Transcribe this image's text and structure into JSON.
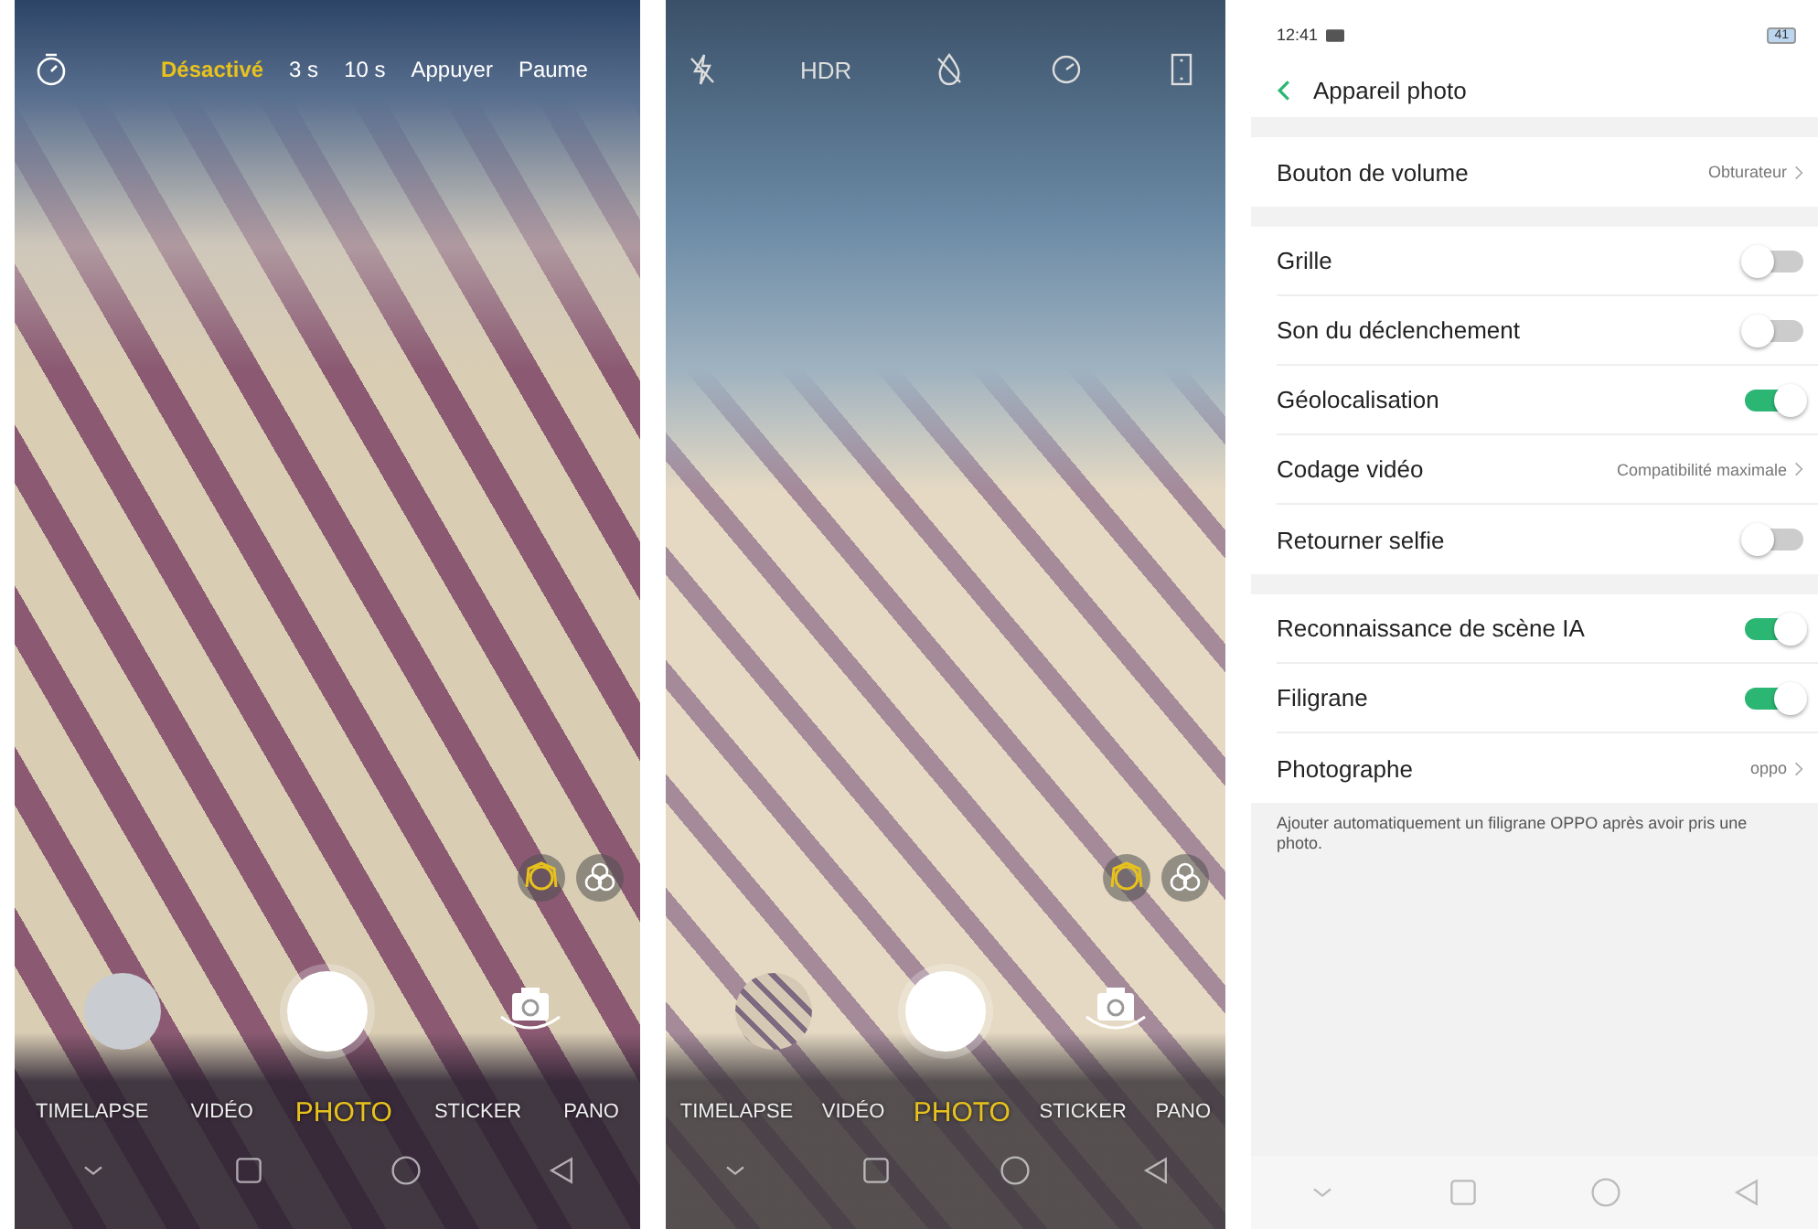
{
  "camera_timer_screen": {
    "timer_options": [
      {
        "label": "Désactivé",
        "selected": true
      },
      {
        "label": "3 s",
        "selected": false
      },
      {
        "label": "10 s",
        "selected": false
      },
      {
        "label": "Appuyer",
        "selected": false
      },
      {
        "label": "Paume",
        "selected": false
      }
    ],
    "modes": [
      {
        "label": "TIMELAPSE",
        "selected": false
      },
      {
        "label": "VIDÉO",
        "selected": false
      },
      {
        "label": "PHOTO",
        "selected": true
      },
      {
        "label": "STICKER",
        "selected": false
      },
      {
        "label": "PANO",
        "selected": false
      }
    ]
  },
  "camera_screen": {
    "hdr_label": "HDR",
    "modes": [
      {
        "label": "TIMELAPSE",
        "selected": false
      },
      {
        "label": "VIDÉO",
        "selected": false
      },
      {
        "label": "PHOTO",
        "selected": true
      },
      {
        "label": "STICKER",
        "selected": false
      },
      {
        "label": "PANO",
        "selected": false
      }
    ]
  },
  "settings_screen": {
    "status_time": "12:41",
    "battery": "41",
    "title": "Appareil photo",
    "groups": [
      [
        {
          "kind": "link",
          "label": "Bouton de volume",
          "value": "Obturateur"
        }
      ],
      [
        {
          "kind": "toggle",
          "label": "Grille",
          "on": false
        },
        {
          "kind": "toggle",
          "label": "Son du déclenchement",
          "on": false
        },
        {
          "kind": "toggle",
          "label": "Géolocalisation",
          "on": true
        },
        {
          "kind": "link",
          "label": "Codage vidéo",
          "value": "Compatibilité maximale"
        },
        {
          "kind": "toggle",
          "label": "Retourner selfie",
          "on": false
        }
      ],
      [
        {
          "kind": "toggle",
          "label": "Reconnaissance de scène IA",
          "on": true
        },
        {
          "kind": "toggle",
          "label": "Filigrane",
          "on": true
        },
        {
          "kind": "link",
          "label": "Photographe",
          "value": "oppo"
        }
      ]
    ],
    "note": "Ajouter automatiquement un filigrane OPPO après avoir pris une photo."
  }
}
